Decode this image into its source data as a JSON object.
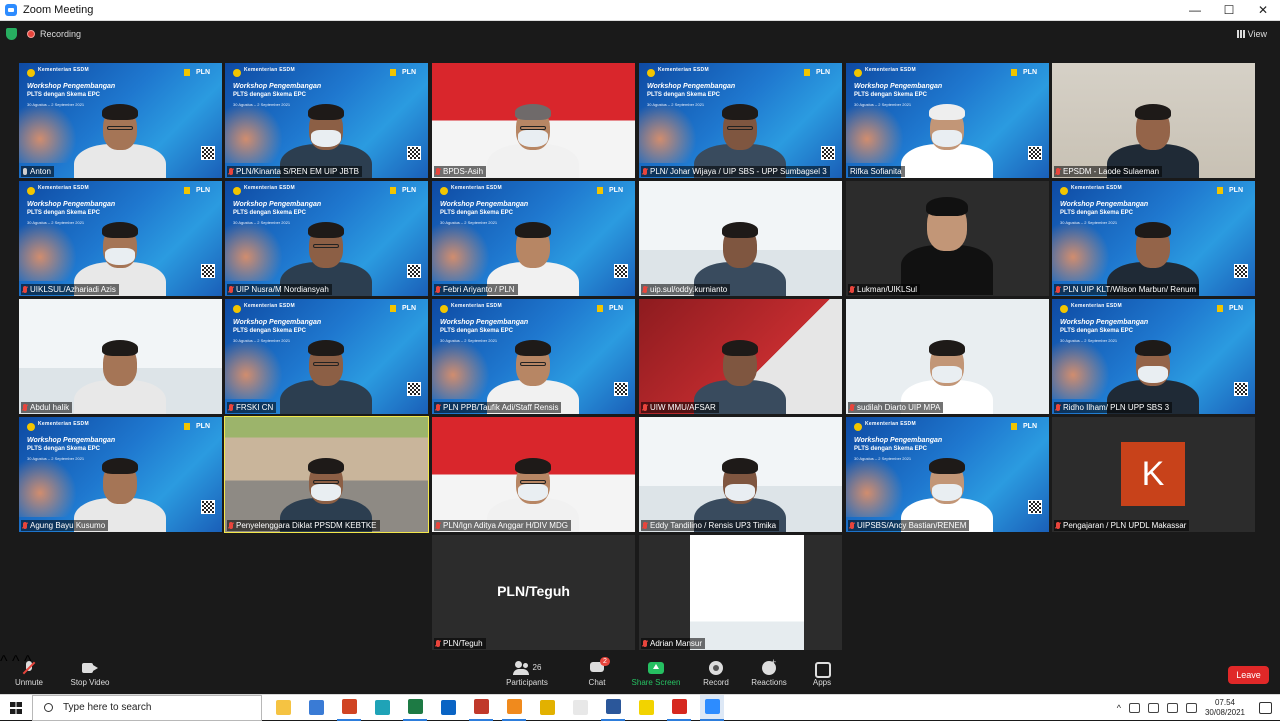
{
  "window": {
    "title": "Zoom Meeting",
    "minimize_glyph": "—",
    "maximize_glyph": "☐",
    "close_glyph": "✕"
  },
  "meeting_bar": {
    "recording_label": "Recording",
    "view_label": "View"
  },
  "banner_text": {
    "org": "PPSDM KEBTKE",
    "org_small": "Kementerian ESDM",
    "brand": "PLN",
    "workshop_line1": "Workshop Pengembangan",
    "workshop_line2": "PLTS dengan Skema EPC",
    "dates": "30 Agustus – 2 September 2021"
  },
  "tiles": [
    {
      "name": "Anton",
      "mic": "on"
    },
    {
      "name": "PLN/Kinanta S/REN EM UIP JBTB",
      "mic": "off"
    },
    {
      "name": "BPDS-Asih",
      "mic": "off"
    },
    {
      "name": "PLN/ Johar Wijaya / UIP SBS - UPP Sumbagsel 3",
      "mic": "off"
    },
    {
      "name": "Rifka Sofianita",
      "mic": "none"
    },
    {
      "name": "EPSDM - Laode Sulaeman",
      "mic": "off"
    },
    {
      "name": "UIKLSUL/Azhariadi Azis",
      "mic": "off"
    },
    {
      "name": "UIP Nusra/M Nordiansyah",
      "mic": "off"
    },
    {
      "name": "Febri Ariyanto / PLN",
      "mic": "off"
    },
    {
      "name": "uip.sul/oddy.kurnianto",
      "mic": "off"
    },
    {
      "name": "Lukman/UIKLSul",
      "mic": "off"
    },
    {
      "name": "PLN UIP KLT/Wilson Marbun/ Renum",
      "mic": "off"
    },
    {
      "name": "Abdul halik",
      "mic": "off"
    },
    {
      "name": "FRSKI CN",
      "mic": "off"
    },
    {
      "name": "PLN PPB/Taufik Adi/Staff Rensis",
      "mic": "off"
    },
    {
      "name": "UIW MMU/AFSAR",
      "mic": "off"
    },
    {
      "name": "sudilah Diarto UIP MPA",
      "mic": "off"
    },
    {
      "name": "Ridho Ilham/ PLN UPP SBS 3",
      "mic": "off"
    },
    {
      "name": "Agung Bayu Kusumo",
      "mic": "off"
    },
    {
      "name": "Penyelenggara Diklat PPSDM KEBTKE",
      "mic": "off"
    },
    {
      "name": "PLN/Ign Aditya Anggar H/DIV MDG",
      "mic": "off"
    },
    {
      "name": "Eddy Tandilino / Rensis UP3 Timika",
      "mic": "off"
    },
    {
      "name": "UIPSBS/Ancy Bastian/RENEM",
      "mic": "off"
    },
    {
      "name": "Pengajaran / PLN UPDL Makassar",
      "mic": "off"
    },
    {
      "name": "PLN/Teguh",
      "mic": "off"
    },
    {
      "name": "Adrian Mansur",
      "mic": "off"
    }
  ],
  "avatar_initial": "K",
  "center_label": "PLN/Teguh",
  "toolbar": {
    "unmute": "Unmute",
    "stop_video": "Stop Video",
    "participants": "Participants",
    "participants_count": "26",
    "chat": "Chat",
    "chat_badge": "2",
    "share_screen": "Share Screen",
    "record": "Record",
    "reactions": "Reactions",
    "apps": "Apps",
    "leave": "Leave",
    "caret": "^"
  },
  "taskbar": {
    "search_placeholder": "Type here to search",
    "time": "07.54",
    "date": "30/08/2021",
    "tray_up": "^",
    "apps": [
      {
        "name": "file-explorer",
        "color": "#f5c342"
      },
      {
        "name": "microsoft-store",
        "color": "#3a7bd5"
      },
      {
        "name": "powerpoint",
        "color": "#d04423"
      },
      {
        "name": "edge",
        "color": "#1fa3b7"
      },
      {
        "name": "excel",
        "color": "#1d7a44"
      },
      {
        "name": "outlook",
        "color": "#0a64c4"
      },
      {
        "name": "app-grid",
        "color": "#c0392b"
      },
      {
        "name": "firefox",
        "color": "#f08a1d"
      },
      {
        "name": "chrome",
        "color": "#e2b100"
      },
      {
        "name": "notepad",
        "color": "#e8e8e8"
      },
      {
        "name": "word",
        "color": "#2b579a"
      },
      {
        "name": "sticky-notes",
        "color": "#f2d300"
      },
      {
        "name": "acrobat",
        "color": "#d6281f"
      },
      {
        "name": "zoom",
        "color": "#2d8cff"
      }
    ]
  }
}
